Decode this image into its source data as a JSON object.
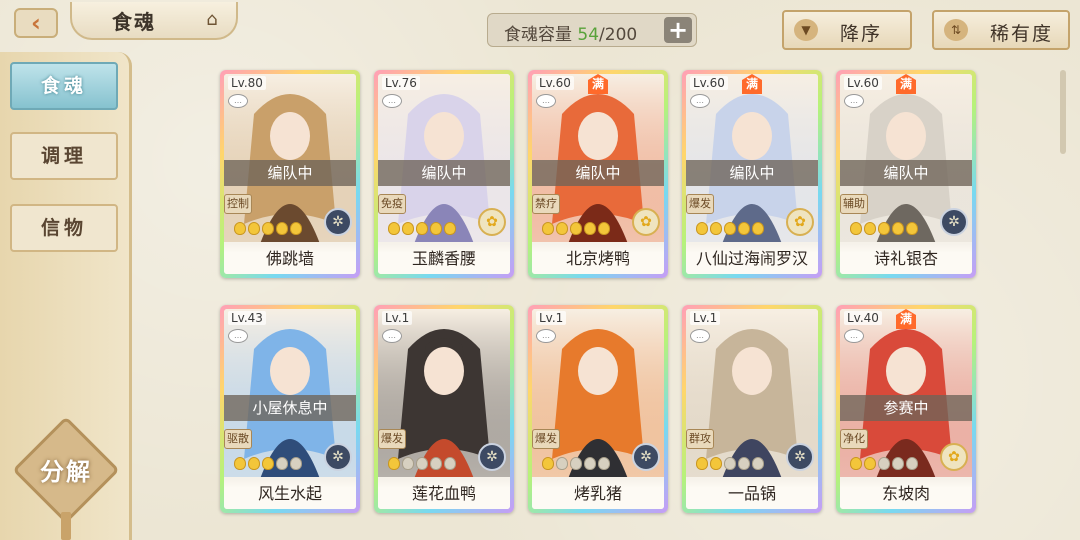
{
  "header": {
    "title": "食魂",
    "capacity_label": "食魂容量",
    "capacity_current": "54",
    "capacity_max": "/200",
    "plus": "+",
    "sort_order": "降序",
    "sort_key": "稀有度"
  },
  "sidebar": {
    "items": [
      {
        "label": "食魂"
      },
      {
        "label": "调理"
      },
      {
        "label": "信物"
      }
    ],
    "decompose": "分解"
  },
  "cards": [
    {
      "lv": "Lv.80",
      "man": "",
      "status": "编队中",
      "role": "控制",
      "stars": 5,
      "elem": "gear",
      "name": "佛跳墙"
    },
    {
      "lv": "Lv.76",
      "man": "",
      "status": "编队中",
      "role": "免疫",
      "stars": 5,
      "elem": "gold",
      "name": "玉麟香腰"
    },
    {
      "lv": "Lv.60",
      "man": "满",
      "status": "编队中",
      "role": "禁疗",
      "stars": 5,
      "elem": "gold",
      "name": "北京烤鸭"
    },
    {
      "lv": "Lv.60",
      "man": "满",
      "status": "编队中",
      "role": "爆发",
      "stars": 5,
      "elem": "gold",
      "name": "八仙过海闹罗汉"
    },
    {
      "lv": "Lv.60",
      "man": "满",
      "status": "编队中",
      "role": "辅助",
      "stars": 5,
      "elem": "gear",
      "name": "诗礼银杏"
    },
    {
      "lv": "Lv.43",
      "man": "",
      "status": "小屋休息中",
      "role": "驱散",
      "stars": 3,
      "elem": "gear",
      "name": "风生水起"
    },
    {
      "lv": "Lv.1",
      "man": "",
      "status": "",
      "role": "爆发",
      "stars": 1,
      "elem": "gear",
      "name": "莲花血鸭"
    },
    {
      "lv": "Lv.1",
      "man": "",
      "status": "",
      "role": "爆发",
      "stars": 1,
      "elem": "gear",
      "name": "烤乳猪"
    },
    {
      "lv": "Lv.1",
      "man": "",
      "status": "",
      "role": "群攻",
      "stars": 2,
      "elem": "gear",
      "name": "一品锅"
    },
    {
      "lv": "Lv.40",
      "man": "满",
      "status": "参赛中",
      "role": "净化",
      "stars": 2,
      "elem": "gold",
      "name": "东坡肉"
    }
  ],
  "colors": {
    "accent": "#58a23a",
    "active_tab": "#86c2cf"
  }
}
